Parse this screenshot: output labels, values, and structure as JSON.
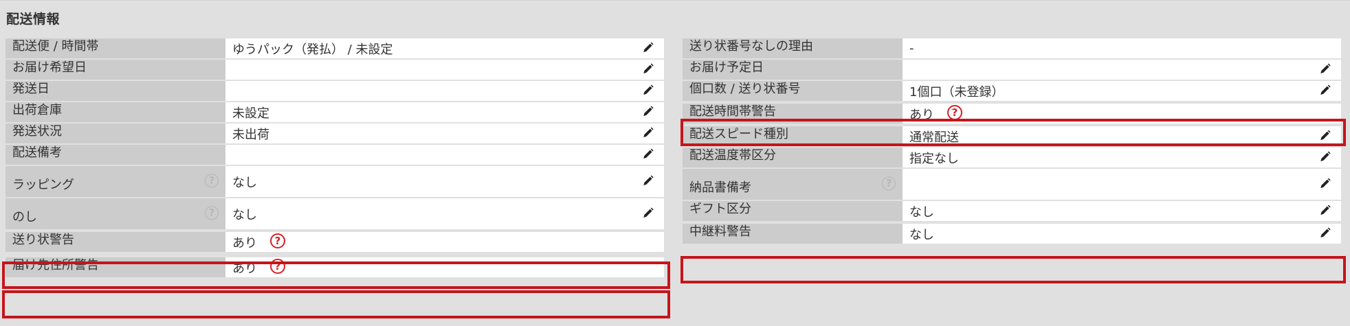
{
  "section": {
    "title": "配送情報"
  },
  "left_rows": [
    {
      "label": "配送便 / 時間帯",
      "value": "ゆうパック（発払） / 未設定"
    },
    {
      "label": "お届け希望日",
      "value": ""
    },
    {
      "label": "発送日",
      "value": ""
    },
    {
      "label": "出荷倉庫",
      "value": "未設定"
    },
    {
      "label": "発送状況",
      "value": "未出荷"
    },
    {
      "label": "配送備考",
      "value": ""
    },
    {
      "label": "ラッピング",
      "value": "なし",
      "help_icon": "?"
    },
    {
      "label": "のし",
      "value": "なし",
      "help_icon": "?"
    },
    {
      "label": "送り状警告",
      "value": "あり",
      "warn_icon": "?"
    },
    {
      "label": "届け先住所警告",
      "value": "あり",
      "warn_icon": "?"
    }
  ],
  "right_rows": [
    {
      "label": "送り状番号なしの理由",
      "value": "-"
    },
    {
      "label": "お届け予定日",
      "value": ""
    },
    {
      "label": "個口数 / 送り状番号",
      "value": "1個口（未登録）"
    },
    {
      "label": "配送時間帯警告",
      "value": "あり",
      "warn_icon": "?"
    },
    {
      "label": "配送スピード種別",
      "value": "通常配送"
    },
    {
      "label": "配送温度帯区分",
      "value": "指定なし"
    },
    {
      "label": "納品書備考",
      "value": "",
      "help_icon": "?"
    },
    {
      "label": "ギフト区分",
      "value": "なし"
    },
    {
      "label": "中継料警告",
      "value": "なし"
    }
  ],
  "icons": {
    "edit": "pencil-icon",
    "help": "question-circle-icon"
  },
  "colors": {
    "alert_border": "#c4151c",
    "warn_icon": "#d61f24",
    "label_bg": "#cccccc",
    "panel_bg": "#e0e0e0"
  }
}
